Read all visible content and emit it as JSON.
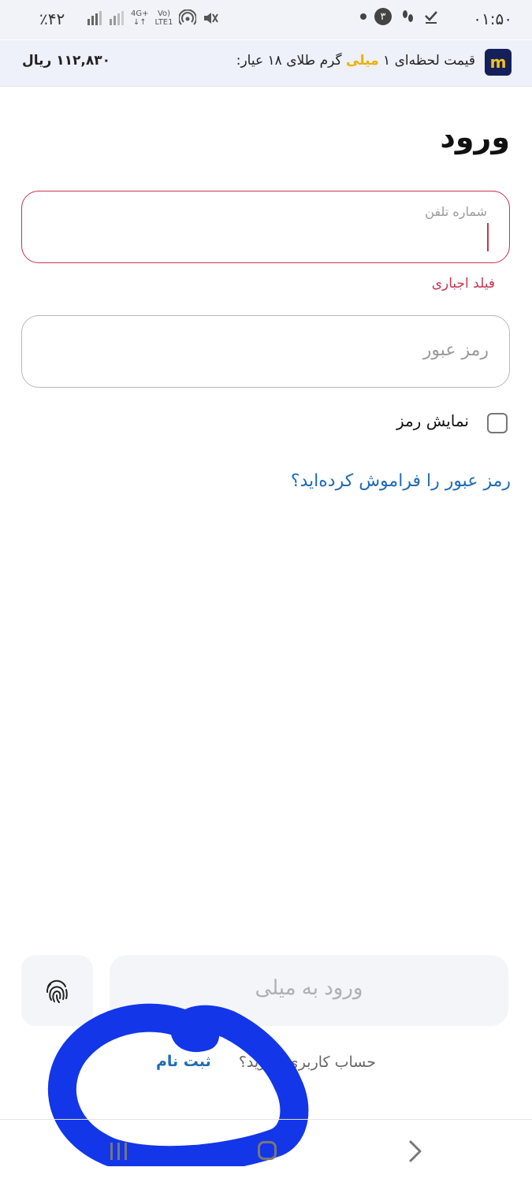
{
  "status_bar": {
    "time": "۰۱:۵۰",
    "notification_count": "۳",
    "battery": "٪۴۲",
    "network_label_top": "4G+",
    "network_label_bottom": "LTE1"
  },
  "ticker": {
    "logo_letter": "m",
    "text_before": "قیمت لحظه‌ای ۱",
    "brand": "میلی",
    "text_after": "گرم طلای ۱۸ عیار:",
    "price": "۱۱۲,۸۳۰ ریال"
  },
  "page": {
    "title": "ورود"
  },
  "phone": {
    "label": "شماره تلفن",
    "error": "فیلد اجباری"
  },
  "password": {
    "placeholder": "رمز عبور"
  },
  "show_password": {
    "label": "نمایش رمز",
    "checked": false
  },
  "forgot_password": {
    "label": "رمز عبور را فراموش کرده‌اید؟"
  },
  "login_button": {
    "label": "ورود به میلی"
  },
  "signup": {
    "prompt": "حساب کاربری ندارید؟",
    "link": "ثبت نام"
  },
  "colors": {
    "error": "#c8354f",
    "link": "#1f6bb5",
    "brand_gold": "#e8b300",
    "annotation": "#1336e8"
  },
  "icons": [
    "fingerprint-icon",
    "recents-icon",
    "home-icon",
    "back-icon"
  ]
}
